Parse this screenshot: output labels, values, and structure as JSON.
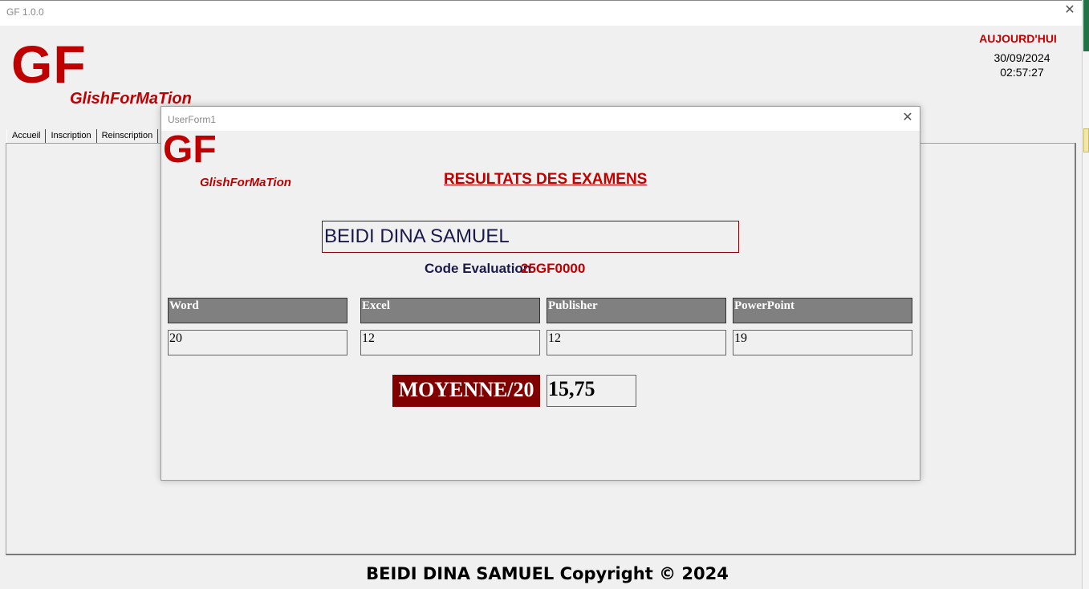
{
  "window": {
    "title": "GF 1.0.0"
  },
  "logo": {
    "letters": "GF",
    "subtitle": "GlishForMaTion"
  },
  "datetime": {
    "label": "AUJOURD'HUI",
    "date": "30/09/2024",
    "time": "02:57:27"
  },
  "tabs": [
    "Accueil",
    "Inscription",
    "Reinscription",
    "F"
  ],
  "footer": "BEIDI DINA SAMUEL Copyright © 2024",
  "dialog": {
    "title": "UserForm1",
    "logo_letters": "GF",
    "logo_subtitle": "GlishForMaTion",
    "heading": "RESULTATS DES EXAMENS",
    "student_name": "BEIDI DINA SAMUEL",
    "code_label": "Code Evaluation",
    "code_value": "25GF0000",
    "subjects": [
      {
        "name": "Word",
        "score": "20"
      },
      {
        "name": "Excel",
        "score": "12"
      },
      {
        "name": "Publisher",
        "score": "12"
      },
      {
        "name": "PowerPoint",
        "score": "19"
      }
    ],
    "average_label": "MOYENNE/20",
    "average_value": "15,75"
  },
  "colors": {
    "brand_red": "#c00000",
    "dark_red": "#800000",
    "header_grey": "#808080",
    "excel_green": "#217346"
  },
  "icons": {
    "close": "close-icon"
  }
}
